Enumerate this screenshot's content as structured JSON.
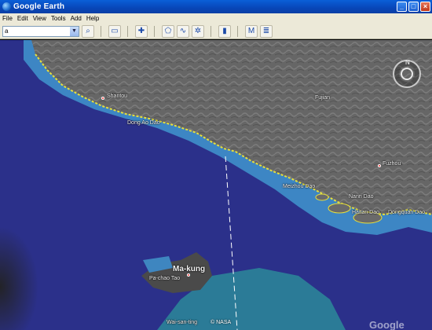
{
  "window": {
    "title": "Google Earth"
  },
  "menu": {
    "items": [
      "File",
      "Edit",
      "View",
      "Tools",
      "Add",
      "Help"
    ]
  },
  "toolbar": {
    "search_value": "a",
    "buttons": [
      "search-icon",
      "sidebar-icon",
      "placemark-icon",
      "polygon-icon",
      "path-icon",
      "overlay-icon",
      "ruler-icon",
      "email-icon",
      "print-icon"
    ]
  },
  "map": {
    "places": [
      {
        "name": "Shantou"
      },
      {
        "name": "Dong Ao Dao"
      },
      {
        "name": "Fujian"
      },
      {
        "name": "Fuzhou"
      },
      {
        "name": "Meizhou Dao"
      },
      {
        "name": "Nanri Dao"
      },
      {
        "name": "Haitan Dao"
      },
      {
        "name": "Dongquan Dao"
      },
      {
        "name": "Ma-kung"
      },
      {
        "name": "Pa-chao Tao"
      },
      {
        "name": "Wai-san-ting"
      }
    ],
    "copyright": "© NASA",
    "watermark": "Google"
  },
  "colors": {
    "sea": "#2a2f8a",
    "land": "#6b6b6b",
    "shallow": "#3f8fc8",
    "coast": "#e8e040",
    "route": "#ffffff"
  }
}
